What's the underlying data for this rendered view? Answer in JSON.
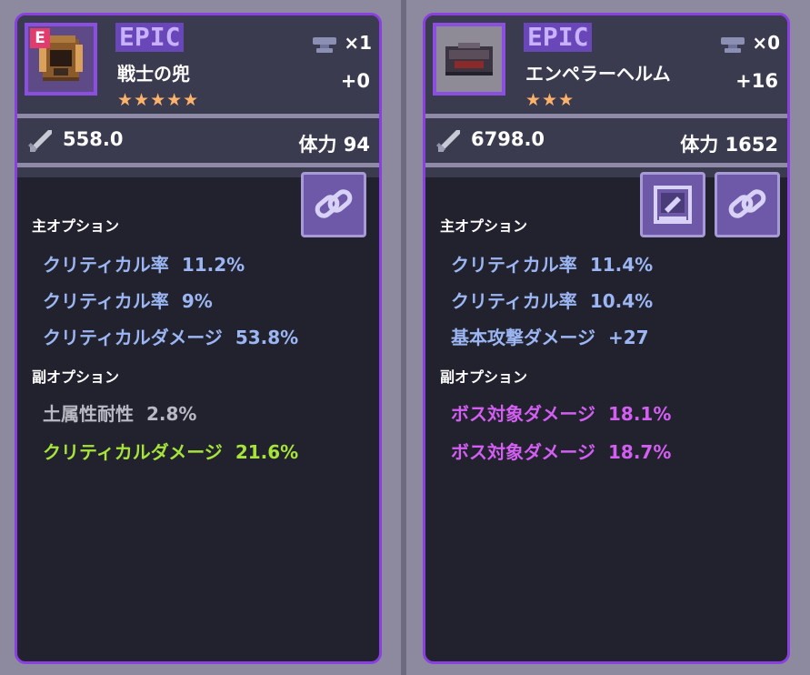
{
  "cards": [
    {
      "rarity": "EPIC",
      "badge": "E",
      "name": "戦士の兜",
      "stars": "★★★★★",
      "count": "×1",
      "enhance": "+0",
      "attack": "558.0",
      "hp_label": "体力 94",
      "main_title": "主オプション",
      "main_options": [
        {
          "label": "クリティカル率",
          "value": "11.2%"
        },
        {
          "label": "クリティカル率",
          "value": "9%"
        },
        {
          "label": "クリティカルダメージ",
          "value": "53.8%"
        }
      ],
      "sub_title": "副オプション",
      "sub_options": [
        {
          "label": "土属性耐性",
          "value": "2.8%"
        },
        {
          "label": "クリティカルダメージ",
          "value": "21.6%"
        }
      ]
    },
    {
      "rarity": "EPIC",
      "name": "エンペラーヘルム",
      "stars": "★★★",
      "count": "×0",
      "enhance": "+16",
      "attack": "6798.0",
      "hp_label": "体力 1652",
      "main_title": "主オプション",
      "main_options": [
        {
          "label": "クリティカル率",
          "value": "11.4%"
        },
        {
          "label": "クリティカル率",
          "value": "10.4%"
        },
        {
          "label": "基本攻撃ダメージ",
          "value": "+27"
        }
      ],
      "sub_title": "副オプション",
      "sub_options": [
        {
          "label": "ボス対象ダメージ",
          "value": "18.1%"
        },
        {
          "label": "ボス対象ダメージ",
          "value": "18.7%"
        }
      ]
    }
  ],
  "colors": {
    "card_border": "#8a3fe0",
    "main_option": "#9bb6f2",
    "sub_gray": "#b9b9c3",
    "sub_green": "#a6e43a",
    "sub_purple": "#d35ef2"
  }
}
